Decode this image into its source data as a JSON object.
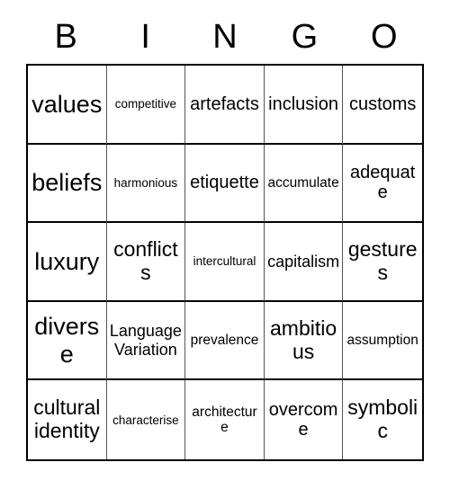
{
  "card": {
    "headers": [
      "B",
      "I",
      "N",
      "G",
      "O"
    ],
    "rows": [
      [
        {
          "text": "values",
          "size": "fs-xxl"
        },
        {
          "text": "competitive",
          "size": "fs-xs"
        },
        {
          "text": "artefacts",
          "size": "fs-lg"
        },
        {
          "text": "inclusion",
          "size": "fs-lg"
        },
        {
          "text": "customs",
          "size": "fs-lg"
        }
      ],
      [
        {
          "text": "beliefs",
          "size": "fs-xxl"
        },
        {
          "text": "harmonious",
          "size": "fs-xs"
        },
        {
          "text": "etiquette",
          "size": "fs-lg"
        },
        {
          "text": "accumulate",
          "size": "fs-sm"
        },
        {
          "text": "adequate",
          "size": "fs-lg"
        }
      ],
      [
        {
          "text": "luxury",
          "size": "fs-xxl"
        },
        {
          "text": "conflicts",
          "size": "fs-xl"
        },
        {
          "text": "intercultural",
          "size": "fs-xs"
        },
        {
          "text": "capitalism",
          "size": "fs-md"
        },
        {
          "text": "gestures",
          "size": "fs-xl"
        }
      ],
      [
        {
          "text": "diverse",
          "size": "fs-xxl"
        },
        {
          "text": "Language\nVariation",
          "size": "fs-md"
        },
        {
          "text": "prevalence",
          "size": "fs-sm"
        },
        {
          "text": "ambitious",
          "size": "fs-xl"
        },
        {
          "text": "assumption",
          "size": "fs-sm"
        }
      ],
      [
        {
          "text": "cultural\nidentity",
          "size": "fs-xl"
        },
        {
          "text": "characterise",
          "size": "fs-xs"
        },
        {
          "text": "architecture",
          "size": "fs-sm"
        },
        {
          "text": "overcome",
          "size": "fs-lg"
        },
        {
          "text": "symbolic",
          "size": "fs-xl"
        }
      ]
    ]
  },
  "colors": {
    "background": "#ffffff",
    "text": "#000000",
    "grid_outer_border": "#000000",
    "grid_row_divider": "#000000",
    "grid_column_divider": "#555555"
  }
}
